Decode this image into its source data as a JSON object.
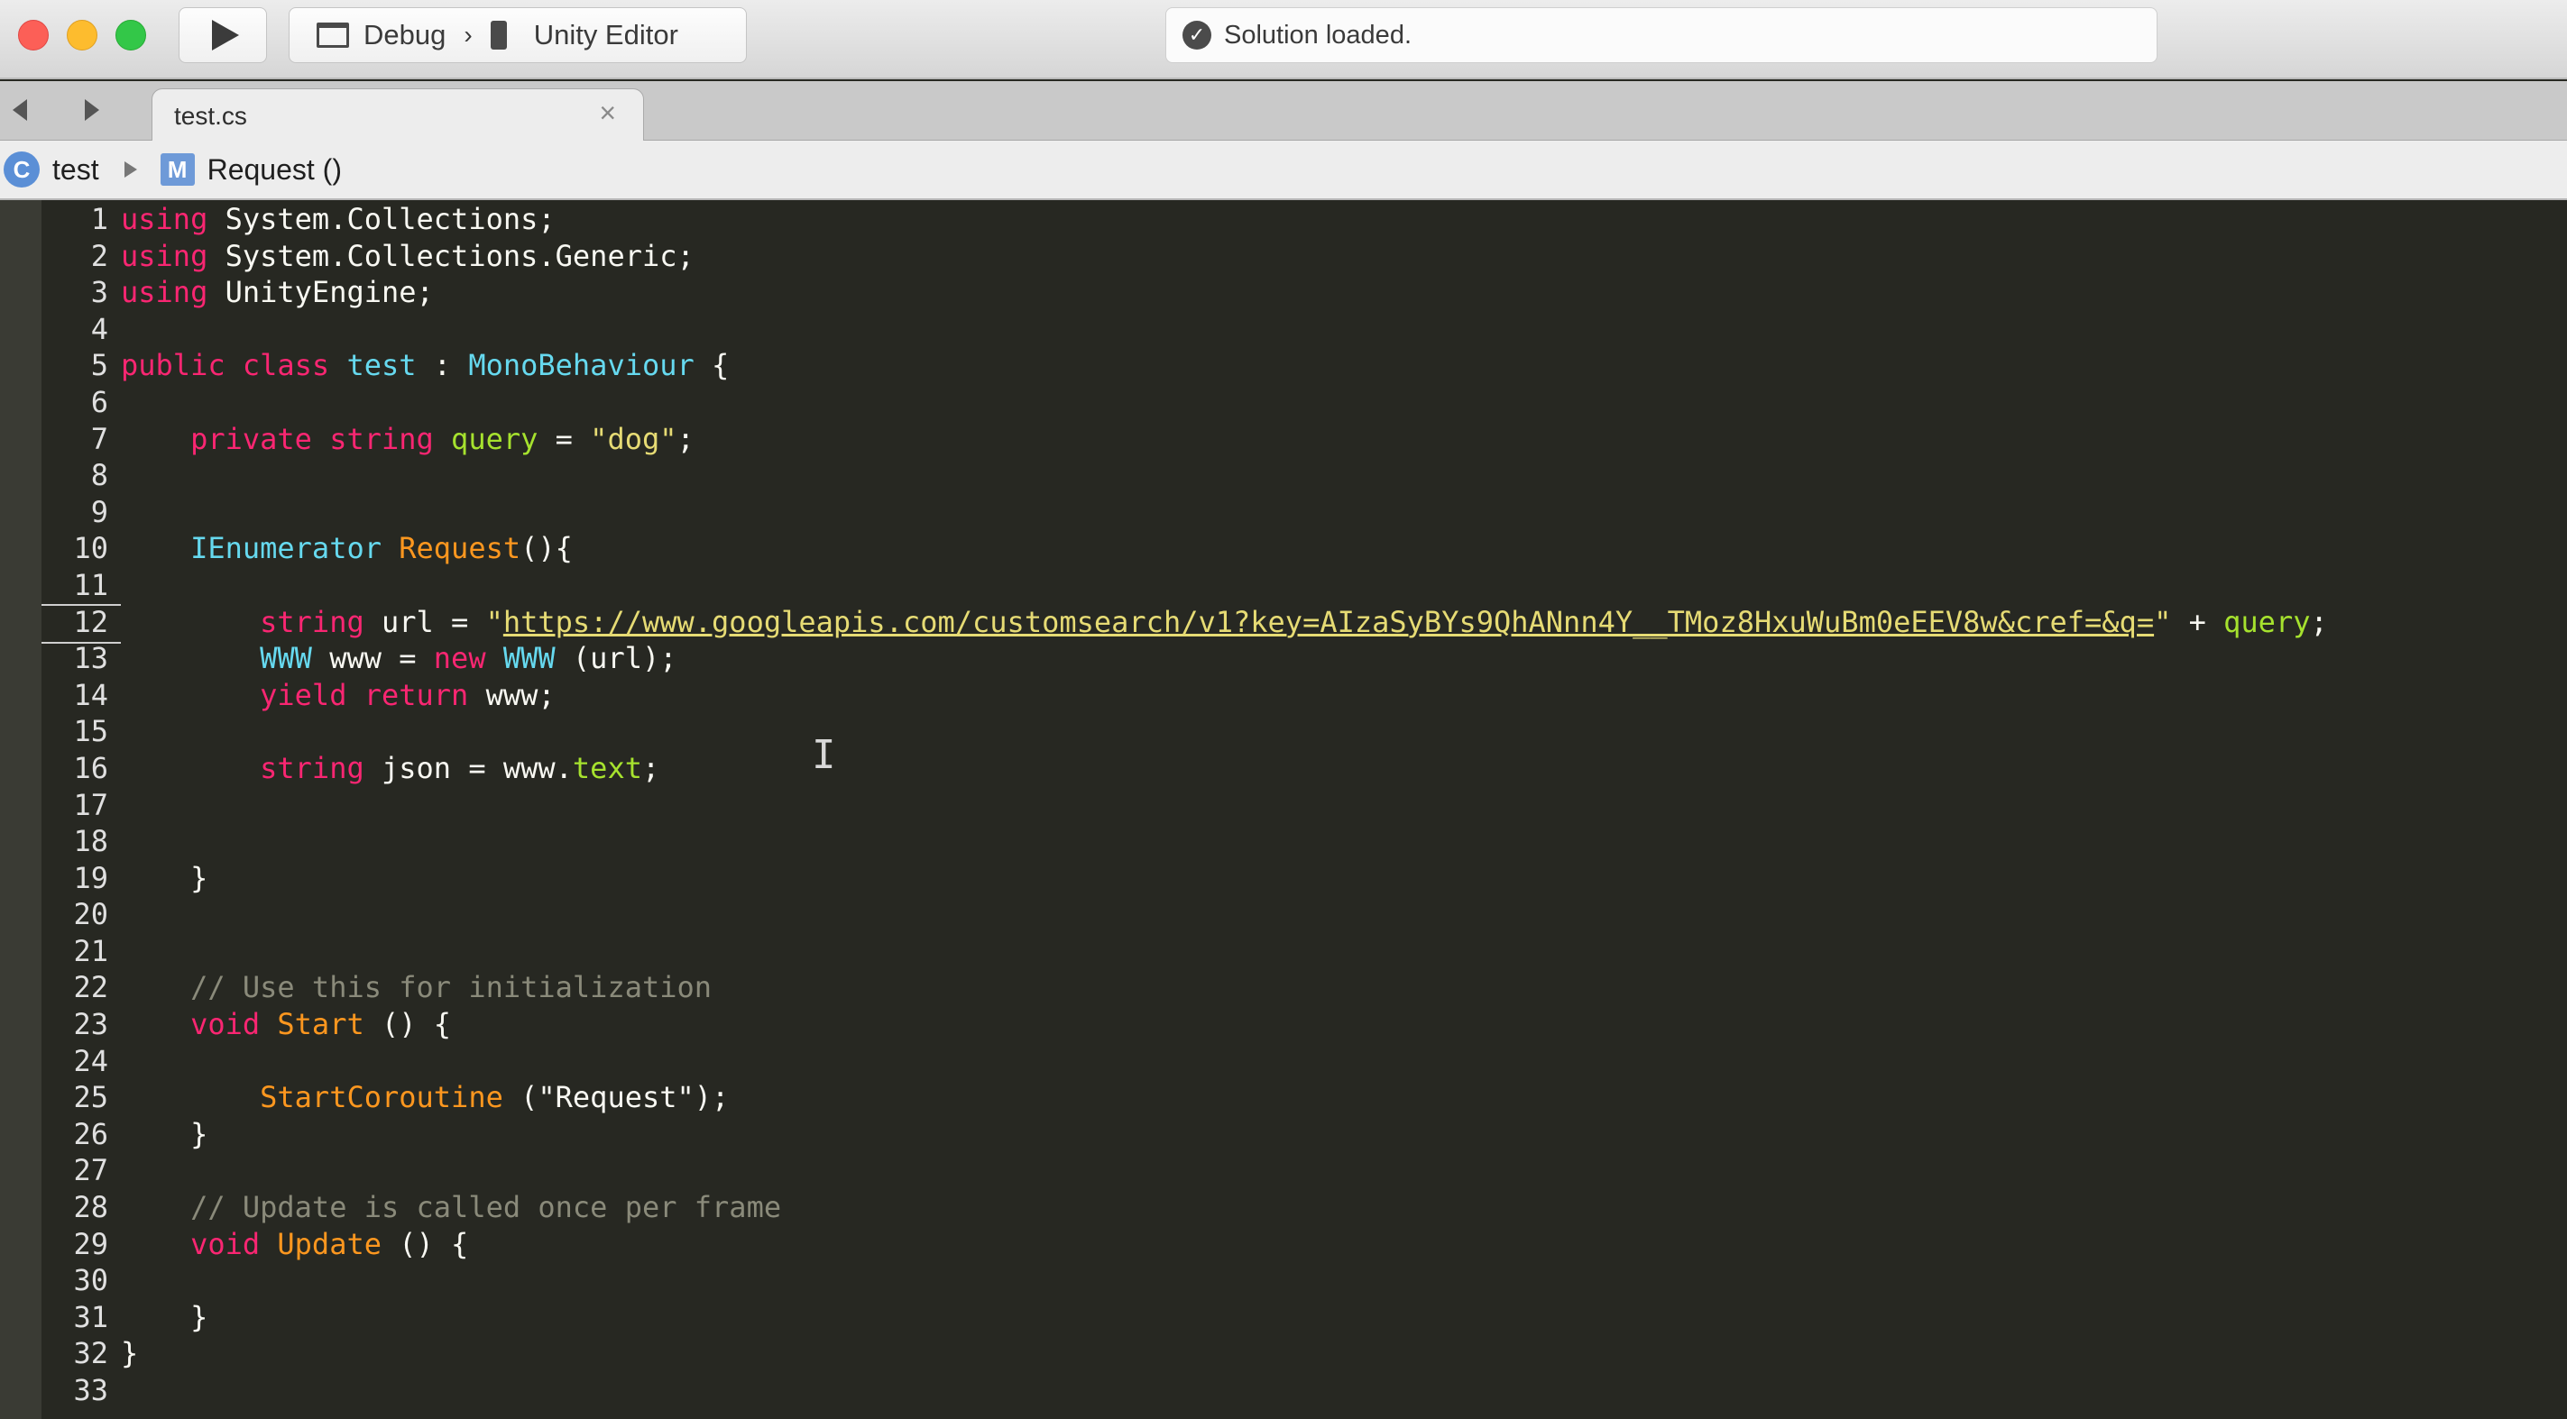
{
  "toolbar": {
    "configuration": "Debug",
    "target": "Unity Editor",
    "status_text": "Solution loaded."
  },
  "tabs": [
    {
      "label": "test.cs",
      "active": true
    }
  ],
  "breadcrumb": {
    "class_name": "test",
    "member_name": "Request ()"
  },
  "editor": {
    "current_line": 12,
    "lines": [
      {
        "n": "1",
        "t": [
          [
            "kw",
            "using"
          ],
          [
            "pl",
            " System.Collections;"
          ]
        ]
      },
      {
        "n": "2",
        "t": [
          [
            "kw",
            "using"
          ],
          [
            "pl",
            " System.Collections.Generic;"
          ]
        ]
      },
      {
        "n": "3",
        "t": [
          [
            "kw",
            "using"
          ],
          [
            "pl",
            " UnityEngine;"
          ]
        ]
      },
      {
        "n": "4",
        "t": []
      },
      {
        "n": "5",
        "t": [
          [
            "kw",
            "public"
          ],
          [
            "pl",
            " "
          ],
          [
            "kw",
            "class"
          ],
          [
            "pl",
            " "
          ],
          [
            "ty",
            "test"
          ],
          [
            "pl",
            " : "
          ],
          [
            "ty",
            "MonoBehaviour"
          ],
          [
            "pl",
            " {"
          ]
        ]
      },
      {
        "n": "6",
        "t": []
      },
      {
        "n": "7",
        "t": [
          [
            "pl",
            "    "
          ],
          [
            "kw",
            "private"
          ],
          [
            "pl",
            " "
          ],
          [
            "kw",
            "string"
          ],
          [
            "pl",
            " "
          ],
          [
            "id",
            "query"
          ],
          [
            "pl",
            " = "
          ],
          [
            "str",
            "\"dog\""
          ],
          [
            "pl",
            ";"
          ]
        ]
      },
      {
        "n": "8",
        "t": []
      },
      {
        "n": "9",
        "t": []
      },
      {
        "n": "10",
        "t": [
          [
            "pl",
            "    "
          ],
          [
            "ty",
            "IEnumerator"
          ],
          [
            "pl",
            " "
          ],
          [
            "fn",
            "Request"
          ],
          [
            "pl",
            "(){"
          ]
        ]
      },
      {
        "n": "11",
        "t": []
      },
      {
        "n": "12",
        "t": [
          [
            "pl",
            "        "
          ],
          [
            "kw",
            "string"
          ],
          [
            "pl",
            " url = "
          ],
          [
            "str",
            "\""
          ],
          [
            "strurl",
            "https://www.googleapis.com/customsearch/v1?key=AIzaSyBYs9QhANnn4Y__TMoz8HxuWuBm0eEEV8w&cref=&q="
          ],
          [
            "str",
            "\""
          ],
          [
            "pl",
            " + "
          ],
          [
            "id",
            "query"
          ],
          [
            "pl",
            ";"
          ]
        ]
      },
      {
        "n": "13",
        "t": [
          [
            "pl",
            "        "
          ],
          [
            "ty",
            "WWW"
          ],
          [
            "pl",
            " www = "
          ],
          [
            "kw",
            "new"
          ],
          [
            "pl",
            " "
          ],
          [
            "ty",
            "WWW"
          ],
          [
            "pl",
            " (url);"
          ]
        ]
      },
      {
        "n": "14",
        "t": [
          [
            "pl",
            "        "
          ],
          [
            "kw",
            "yield"
          ],
          [
            "pl",
            " "
          ],
          [
            "kw",
            "return"
          ],
          [
            "pl",
            " www;"
          ]
        ]
      },
      {
        "n": "15",
        "t": []
      },
      {
        "n": "16",
        "t": [
          [
            "pl",
            "        "
          ],
          [
            "kw",
            "string"
          ],
          [
            "pl",
            " json = www."
          ],
          [
            "id",
            "text"
          ],
          [
            "pl",
            ";"
          ]
        ]
      },
      {
        "n": "17",
        "t": []
      },
      {
        "n": "18",
        "t": []
      },
      {
        "n": "19",
        "t": [
          [
            "pl",
            "    }"
          ]
        ]
      },
      {
        "n": "20",
        "t": []
      },
      {
        "n": "21",
        "t": []
      },
      {
        "n": "22",
        "t": [
          [
            "pl",
            "    "
          ],
          [
            "cm",
            "// Use this for initialization"
          ]
        ]
      },
      {
        "n": "23",
        "t": [
          [
            "pl",
            "    "
          ],
          [
            "kw",
            "void"
          ],
          [
            "pl",
            " "
          ],
          [
            "fn",
            "Start"
          ],
          [
            "pl",
            " () {"
          ]
        ]
      },
      {
        "n": "24",
        "t": []
      },
      {
        "n": "25",
        "t": [
          [
            "pl",
            "        "
          ],
          [
            "fn",
            "StartCoroutine"
          ],
          [
            "pl",
            " (\"Request\");"
          ]
        ]
      },
      {
        "n": "26",
        "t": [
          [
            "pl",
            "    }"
          ]
        ]
      },
      {
        "n": "27",
        "t": []
      },
      {
        "n": "28",
        "t": [
          [
            "pl",
            "    "
          ],
          [
            "cm",
            "// Update is called once per frame"
          ]
        ]
      },
      {
        "n": "29",
        "t": [
          [
            "pl",
            "    "
          ],
          [
            "kw",
            "void"
          ],
          [
            "pl",
            " "
          ],
          [
            "fn",
            "Update"
          ],
          [
            "pl",
            " () {"
          ]
        ]
      },
      {
        "n": "30",
        "t": []
      },
      {
        "n": "31",
        "t": [
          [
            "pl",
            "    }"
          ]
        ]
      },
      {
        "n": "32",
        "t": [
          [
            "pl",
            "}"
          ]
        ]
      },
      {
        "n": "33",
        "t": []
      }
    ]
  }
}
